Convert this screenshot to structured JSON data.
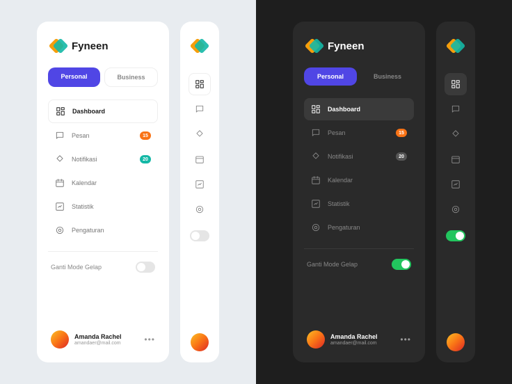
{
  "brand": {
    "name": "Fyneen"
  },
  "tabs": {
    "personal": "Personal",
    "business": "Business"
  },
  "nav": {
    "dashboard": "Dashboard",
    "pesan": "Pesan",
    "notifikasi": "Notifikasi",
    "kalendar": "Kalendar",
    "statistik": "Statistik",
    "pengaturan": "Pengaturan"
  },
  "badges": {
    "pesan": "15",
    "notifikasi": "20"
  },
  "darkMode": {
    "label": "Ganti Mode Gelap"
  },
  "user": {
    "name": "Amanda Rachel",
    "email": "amandaer@mail.com"
  },
  "colors": {
    "primary": "#5046e5",
    "badgeOrange": "#f97316",
    "badgeGreen": "#14b8a6",
    "toggleOn": "#22c55e"
  }
}
